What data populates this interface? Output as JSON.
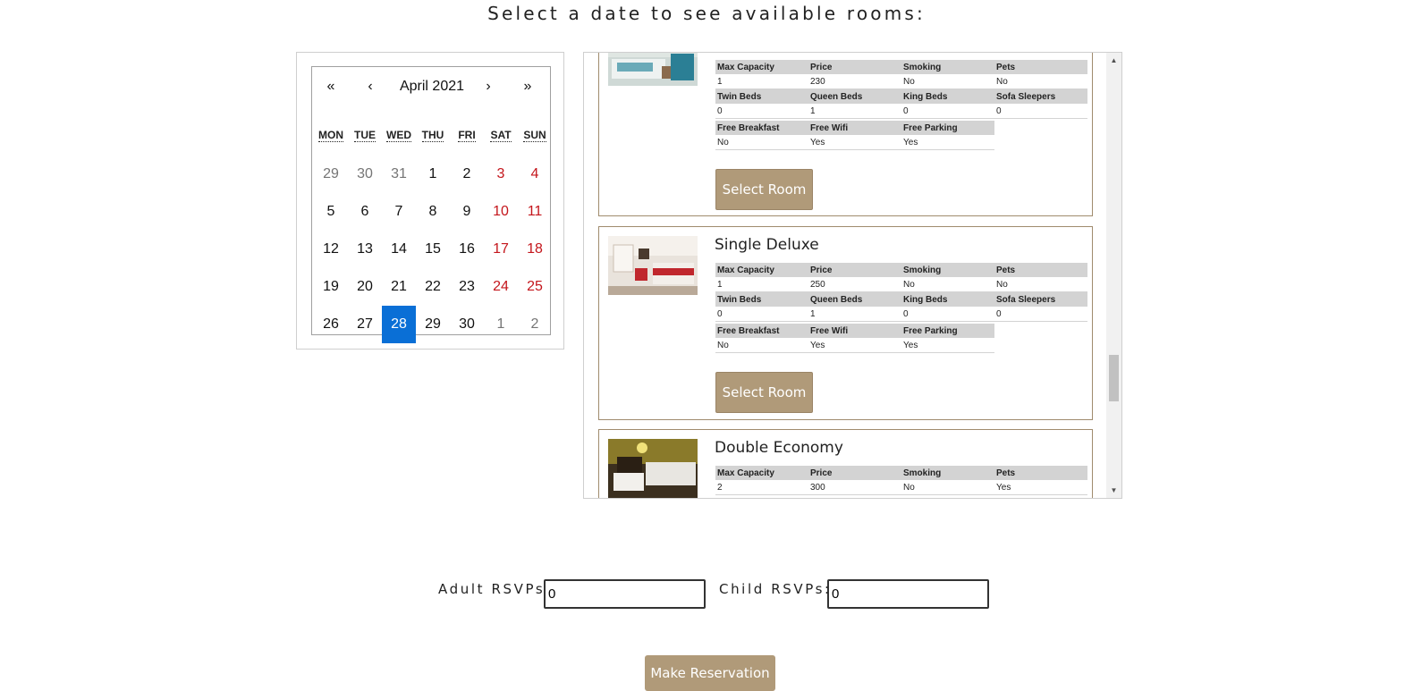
{
  "page": {
    "title": "Select a date to see available rooms:"
  },
  "calendar": {
    "nav": {
      "prev_year": "«",
      "prev_month": "‹",
      "next_month": "›",
      "next_year": "»"
    },
    "month_label": "April 2021",
    "weekdays": [
      "MON",
      "TUE",
      "WED",
      "THU",
      "FRI",
      "SAT",
      "SUN"
    ],
    "days": [
      {
        "d": "29",
        "t": "other"
      },
      {
        "d": "30",
        "t": "other"
      },
      {
        "d": "31",
        "t": "other"
      },
      {
        "d": "1",
        "t": ""
      },
      {
        "d": "2",
        "t": ""
      },
      {
        "d": "3",
        "t": "weekend"
      },
      {
        "d": "4",
        "t": "weekend"
      },
      {
        "d": "5",
        "t": ""
      },
      {
        "d": "6",
        "t": ""
      },
      {
        "d": "7",
        "t": ""
      },
      {
        "d": "8",
        "t": ""
      },
      {
        "d": "9",
        "t": ""
      },
      {
        "d": "10",
        "t": "weekend"
      },
      {
        "d": "11",
        "t": "weekend"
      },
      {
        "d": "12",
        "t": ""
      },
      {
        "d": "13",
        "t": ""
      },
      {
        "d": "14",
        "t": ""
      },
      {
        "d": "15",
        "t": ""
      },
      {
        "d": "16",
        "t": ""
      },
      {
        "d": "17",
        "t": "weekend"
      },
      {
        "d": "18",
        "t": "weekend"
      },
      {
        "d": "19",
        "t": ""
      },
      {
        "d": "20",
        "t": ""
      },
      {
        "d": "21",
        "t": ""
      },
      {
        "d": "22",
        "t": ""
      },
      {
        "d": "23",
        "t": ""
      },
      {
        "d": "24",
        "t": "weekend"
      },
      {
        "d": "25",
        "t": "weekend"
      },
      {
        "d": "26",
        "t": ""
      },
      {
        "d": "27",
        "t": ""
      },
      {
        "d": "28",
        "t": "selected"
      },
      {
        "d": "29",
        "t": ""
      },
      {
        "d": "30",
        "t": ""
      },
      {
        "d": "1",
        "t": "other"
      },
      {
        "d": "2",
        "t": "other"
      }
    ],
    "selected_day": "28"
  },
  "rooms": [
    {
      "name": "",
      "headers1": [
        "Max Capacity",
        "Price",
        "Smoking",
        "Pets"
      ],
      "values1": [
        "1",
        "230",
        "No",
        "No"
      ],
      "headers2": [
        "Twin Beds",
        "Queen Beds",
        "King Beds",
        "Sofa Sleepers"
      ],
      "values2": [
        "0",
        "1",
        "0",
        "0"
      ],
      "headers3": [
        "Free Breakfast",
        "Free Wifi",
        "Free Parking"
      ],
      "values3": [
        "No",
        "Yes",
        "Yes"
      ],
      "button": "Select Room"
    },
    {
      "name": "Single Deluxe",
      "headers1": [
        "Max Capacity",
        "Price",
        "Smoking",
        "Pets"
      ],
      "values1": [
        "1",
        "250",
        "No",
        "No"
      ],
      "headers2": [
        "Twin Beds",
        "Queen Beds",
        "King Beds",
        "Sofa Sleepers"
      ],
      "values2": [
        "0",
        "1",
        "0",
        "0"
      ],
      "headers3": [
        "Free Breakfast",
        "Free Wifi",
        "Free Parking"
      ],
      "values3": [
        "No",
        "Yes",
        "Yes"
      ],
      "button": "Select Room"
    },
    {
      "name": "Double Economy",
      "headers1": [
        "Max Capacity",
        "Price",
        "Smoking",
        "Pets"
      ],
      "values1": [
        "2",
        "300",
        "No",
        "Yes"
      ]
    }
  ],
  "rsvp": {
    "adult_label": "Adult RSVPs",
    "adult_value": "0",
    "child_label": "Child RSVPs:",
    "child_value": "0"
  },
  "actions": {
    "make_reservation": "Make Reservation"
  },
  "colors": {
    "accent": "#b09a79",
    "selected_day": "#0a6fd6",
    "weekend": "#c4161c"
  }
}
